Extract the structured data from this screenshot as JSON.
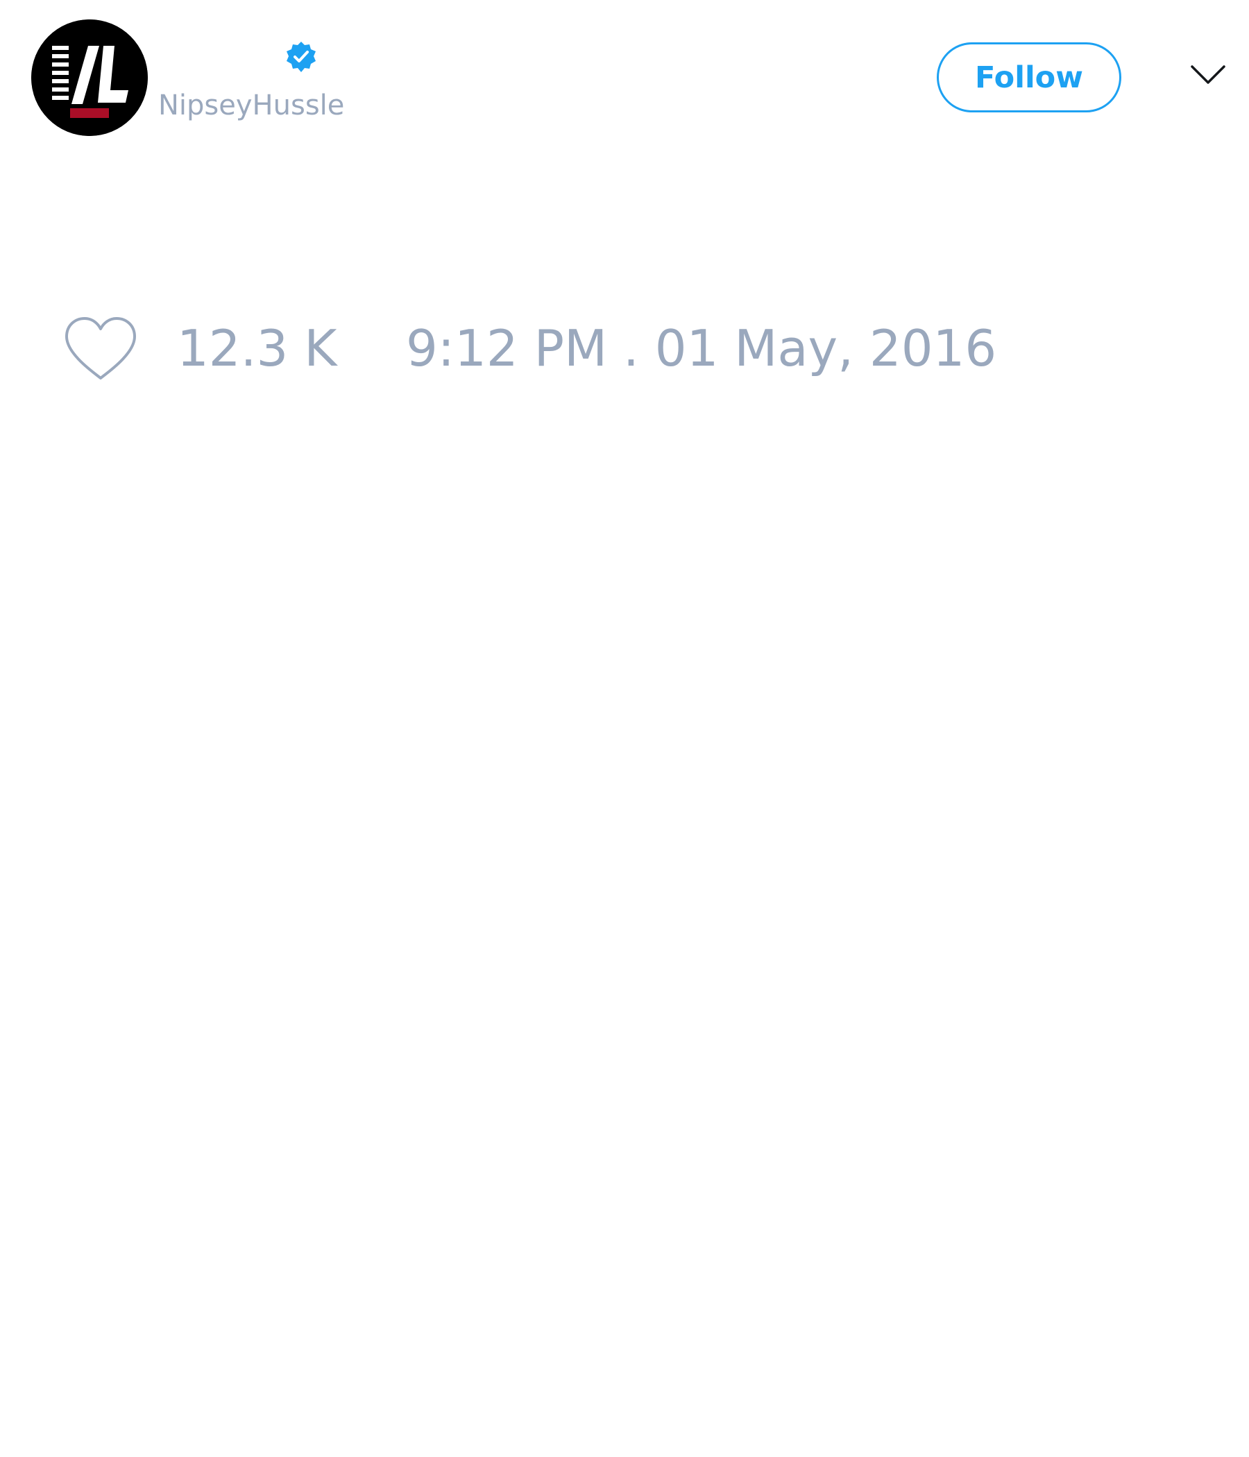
{
  "tweet": {
    "author": {
      "handle": "NipseyHussle",
      "verified": true,
      "avatar_icon": "avatar-logo-icon"
    },
    "follow_label": "Follow",
    "menu_icon": "chevron-down-icon",
    "like_icon": "heart-icon",
    "like_count": "12.3 K",
    "timestamp": "9:12 PM . 01 May, 2016"
  },
  "colors": {
    "accent": "#1da1f2",
    "muted_text": "#9aa8bd",
    "background": "#ffffff"
  }
}
